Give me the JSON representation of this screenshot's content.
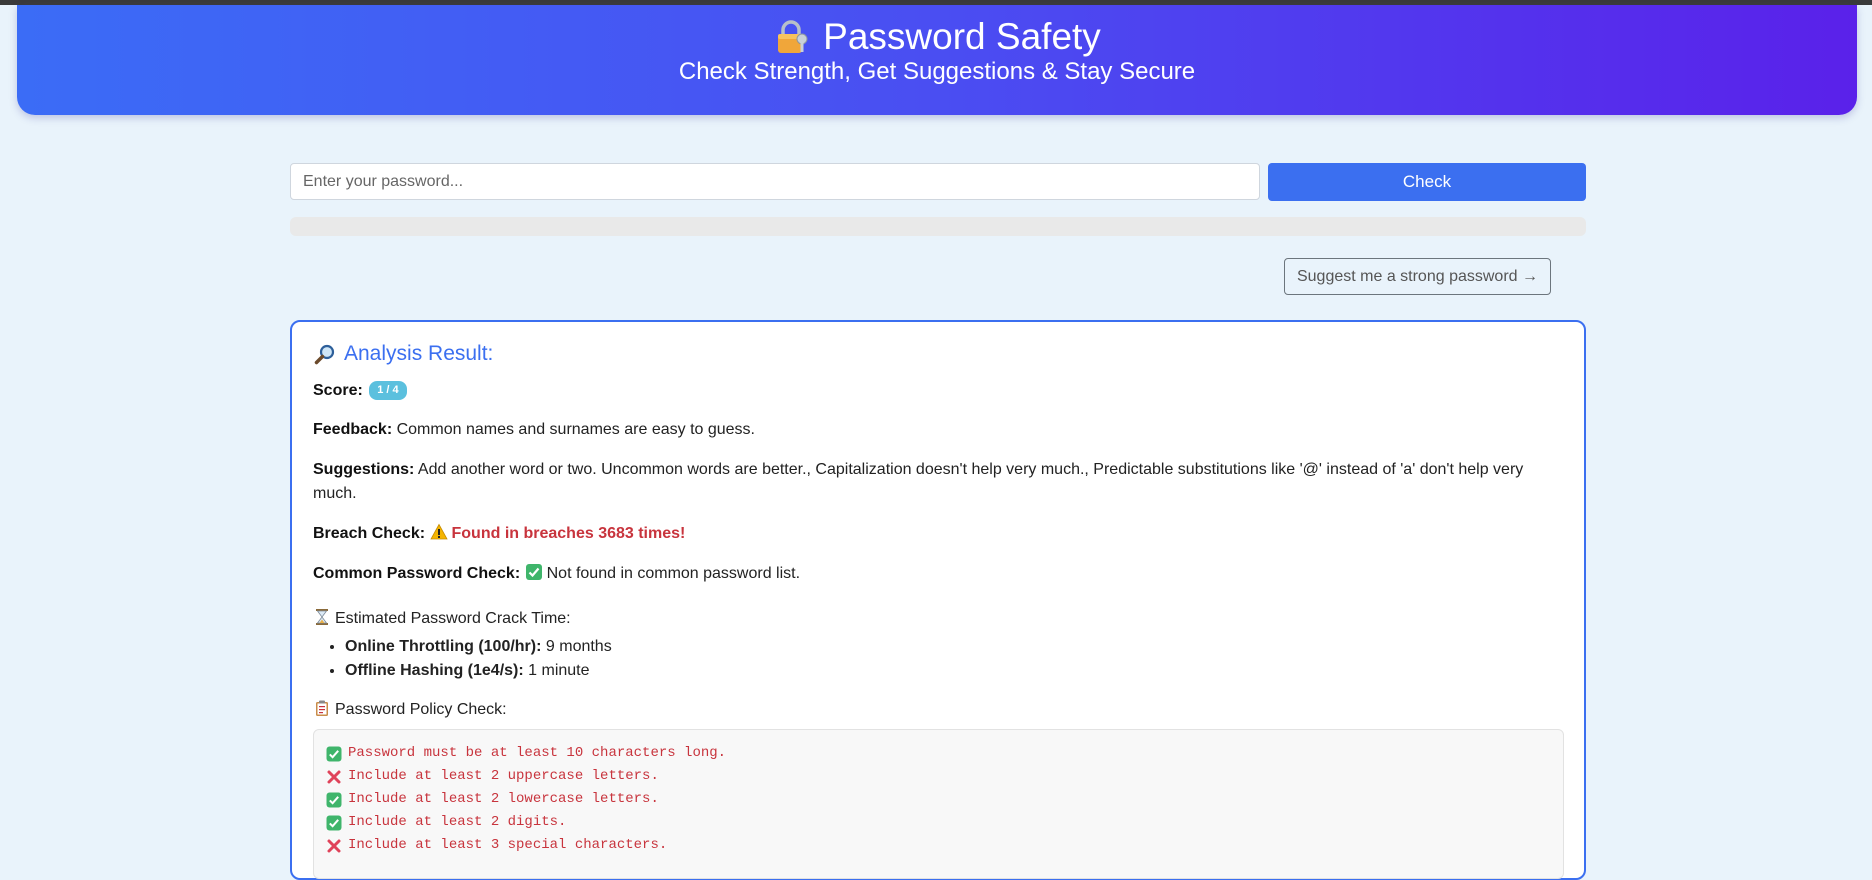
{
  "header": {
    "title": "Password Safety",
    "subtitle": "Check Strength, Get Suggestions & Stay Secure",
    "icon": "lock-key-icon",
    "gradient_start": "#3b6cf6",
    "gradient_end": "#5a21ea"
  },
  "form": {
    "password_placeholder": "Enter your password...",
    "password_value": "",
    "check_label": "Check",
    "strength_level": 0,
    "suggest_label": "Suggest me a strong password →"
  },
  "result": {
    "heading": "Analysis Result:",
    "score_label": "Score:",
    "score_value": "1 / 4",
    "feedback_label": "Feedback:",
    "feedback_text": "Common names and surnames are easy to guess.",
    "suggestions_label": "Suggestions:",
    "suggestions_text": "Add another word or two. Uncommon words are better., Capitalization doesn't help very much., Predictable substitutions like '@' instead of 'a' don't help very much.",
    "breach_label": "Breach Check:",
    "breach_text": "Found in breaches 3683 times!",
    "common_label": "Common Password Check:",
    "common_text": "Not found in common password list.",
    "crack_heading": "Estimated Password Crack Time:",
    "crack_times": [
      {
        "label": "Online Throttling (100/hr):",
        "value": "9 months"
      },
      {
        "label": "Offline Hashing (1e4/s):",
        "value": "1 minute"
      }
    ],
    "policy_heading": "Password Policy Check:",
    "policy_items": [
      {
        "status": "pass",
        "text": "Password must be at least 10 characters long."
      },
      {
        "status": "fail",
        "text": "Include at least 2 uppercase letters."
      },
      {
        "status": "pass",
        "text": "Include at least 2 lowercase letters."
      },
      {
        "status": "pass",
        "text": "Include at least 2 digits."
      },
      {
        "status": "fail",
        "text": "Include at least 3 special characters."
      }
    ]
  },
  "colors": {
    "accent": "#3b6ff0",
    "danger": "#c8343d",
    "badge": "#5bc0de",
    "pass": "#3fb56b",
    "fail": "#e0435a"
  }
}
